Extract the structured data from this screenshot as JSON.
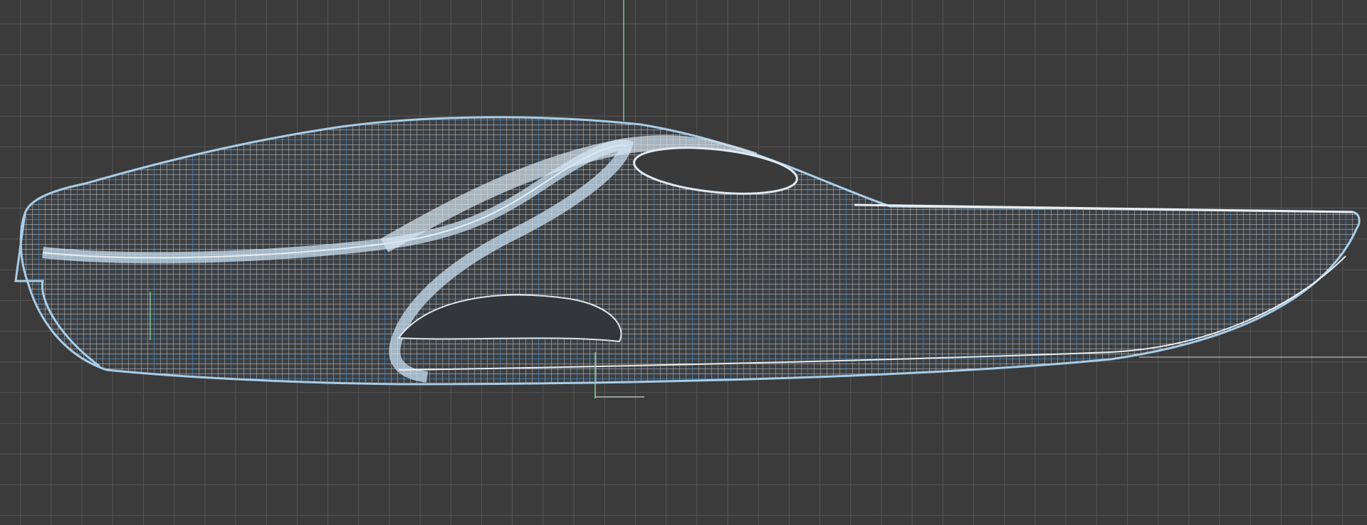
{
  "viewport": {
    "view": "side",
    "display_mode": "wireframe",
    "grid": true,
    "object": "car-body-wireframe"
  },
  "colors": {
    "background": "#3b3b3b",
    "grid_line": "#555555",
    "wire_white": "#e8eef2",
    "wire_blue": "#3a8fd6",
    "axis_green": "#7fd9a0"
  },
  "icons": {
    "world_axis": "axis-gizmo-icon",
    "pivot": "pivot-icon"
  }
}
